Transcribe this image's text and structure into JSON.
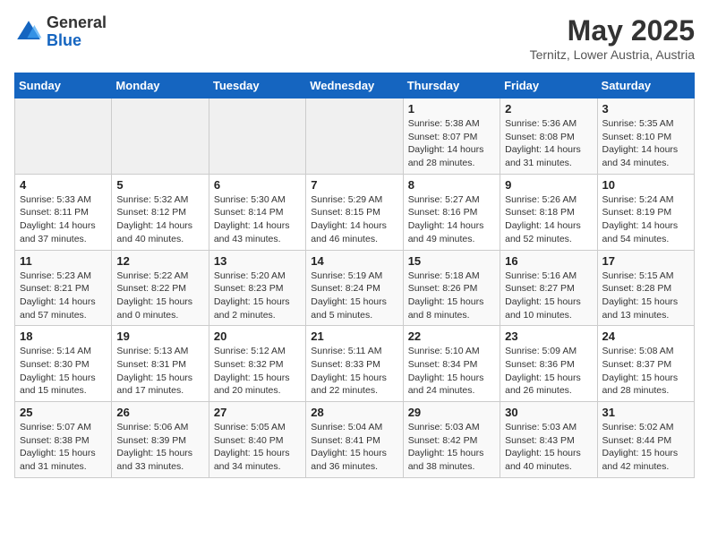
{
  "header": {
    "logo_general": "General",
    "logo_blue": "Blue",
    "month_year": "May 2025",
    "location": "Ternitz, Lower Austria, Austria"
  },
  "weekdays": [
    "Sunday",
    "Monday",
    "Tuesday",
    "Wednesday",
    "Thursday",
    "Friday",
    "Saturday"
  ],
  "weeks": [
    [
      {
        "day": "",
        "info": ""
      },
      {
        "day": "",
        "info": ""
      },
      {
        "day": "",
        "info": ""
      },
      {
        "day": "",
        "info": ""
      },
      {
        "day": "1",
        "info": "Sunrise: 5:38 AM\nSunset: 8:07 PM\nDaylight: 14 hours\nand 28 minutes."
      },
      {
        "day": "2",
        "info": "Sunrise: 5:36 AM\nSunset: 8:08 PM\nDaylight: 14 hours\nand 31 minutes."
      },
      {
        "day": "3",
        "info": "Sunrise: 5:35 AM\nSunset: 8:10 PM\nDaylight: 14 hours\nand 34 minutes."
      }
    ],
    [
      {
        "day": "4",
        "info": "Sunrise: 5:33 AM\nSunset: 8:11 PM\nDaylight: 14 hours\nand 37 minutes."
      },
      {
        "day": "5",
        "info": "Sunrise: 5:32 AM\nSunset: 8:12 PM\nDaylight: 14 hours\nand 40 minutes."
      },
      {
        "day": "6",
        "info": "Sunrise: 5:30 AM\nSunset: 8:14 PM\nDaylight: 14 hours\nand 43 minutes."
      },
      {
        "day": "7",
        "info": "Sunrise: 5:29 AM\nSunset: 8:15 PM\nDaylight: 14 hours\nand 46 minutes."
      },
      {
        "day": "8",
        "info": "Sunrise: 5:27 AM\nSunset: 8:16 PM\nDaylight: 14 hours\nand 49 minutes."
      },
      {
        "day": "9",
        "info": "Sunrise: 5:26 AM\nSunset: 8:18 PM\nDaylight: 14 hours\nand 52 minutes."
      },
      {
        "day": "10",
        "info": "Sunrise: 5:24 AM\nSunset: 8:19 PM\nDaylight: 14 hours\nand 54 minutes."
      }
    ],
    [
      {
        "day": "11",
        "info": "Sunrise: 5:23 AM\nSunset: 8:21 PM\nDaylight: 14 hours\nand 57 minutes."
      },
      {
        "day": "12",
        "info": "Sunrise: 5:22 AM\nSunset: 8:22 PM\nDaylight: 15 hours\nand 0 minutes."
      },
      {
        "day": "13",
        "info": "Sunrise: 5:20 AM\nSunset: 8:23 PM\nDaylight: 15 hours\nand 2 minutes."
      },
      {
        "day": "14",
        "info": "Sunrise: 5:19 AM\nSunset: 8:24 PM\nDaylight: 15 hours\nand 5 minutes."
      },
      {
        "day": "15",
        "info": "Sunrise: 5:18 AM\nSunset: 8:26 PM\nDaylight: 15 hours\nand 8 minutes."
      },
      {
        "day": "16",
        "info": "Sunrise: 5:16 AM\nSunset: 8:27 PM\nDaylight: 15 hours\nand 10 minutes."
      },
      {
        "day": "17",
        "info": "Sunrise: 5:15 AM\nSunset: 8:28 PM\nDaylight: 15 hours\nand 13 minutes."
      }
    ],
    [
      {
        "day": "18",
        "info": "Sunrise: 5:14 AM\nSunset: 8:30 PM\nDaylight: 15 hours\nand 15 minutes."
      },
      {
        "day": "19",
        "info": "Sunrise: 5:13 AM\nSunset: 8:31 PM\nDaylight: 15 hours\nand 17 minutes."
      },
      {
        "day": "20",
        "info": "Sunrise: 5:12 AM\nSunset: 8:32 PM\nDaylight: 15 hours\nand 20 minutes."
      },
      {
        "day": "21",
        "info": "Sunrise: 5:11 AM\nSunset: 8:33 PM\nDaylight: 15 hours\nand 22 minutes."
      },
      {
        "day": "22",
        "info": "Sunrise: 5:10 AM\nSunset: 8:34 PM\nDaylight: 15 hours\nand 24 minutes."
      },
      {
        "day": "23",
        "info": "Sunrise: 5:09 AM\nSunset: 8:36 PM\nDaylight: 15 hours\nand 26 minutes."
      },
      {
        "day": "24",
        "info": "Sunrise: 5:08 AM\nSunset: 8:37 PM\nDaylight: 15 hours\nand 28 minutes."
      }
    ],
    [
      {
        "day": "25",
        "info": "Sunrise: 5:07 AM\nSunset: 8:38 PM\nDaylight: 15 hours\nand 31 minutes."
      },
      {
        "day": "26",
        "info": "Sunrise: 5:06 AM\nSunset: 8:39 PM\nDaylight: 15 hours\nand 33 minutes."
      },
      {
        "day": "27",
        "info": "Sunrise: 5:05 AM\nSunset: 8:40 PM\nDaylight: 15 hours\nand 34 minutes."
      },
      {
        "day": "28",
        "info": "Sunrise: 5:04 AM\nSunset: 8:41 PM\nDaylight: 15 hours\nand 36 minutes."
      },
      {
        "day": "29",
        "info": "Sunrise: 5:03 AM\nSunset: 8:42 PM\nDaylight: 15 hours\nand 38 minutes."
      },
      {
        "day": "30",
        "info": "Sunrise: 5:03 AM\nSunset: 8:43 PM\nDaylight: 15 hours\nand 40 minutes."
      },
      {
        "day": "31",
        "info": "Sunrise: 5:02 AM\nSunset: 8:44 PM\nDaylight: 15 hours\nand 42 minutes."
      }
    ]
  ]
}
